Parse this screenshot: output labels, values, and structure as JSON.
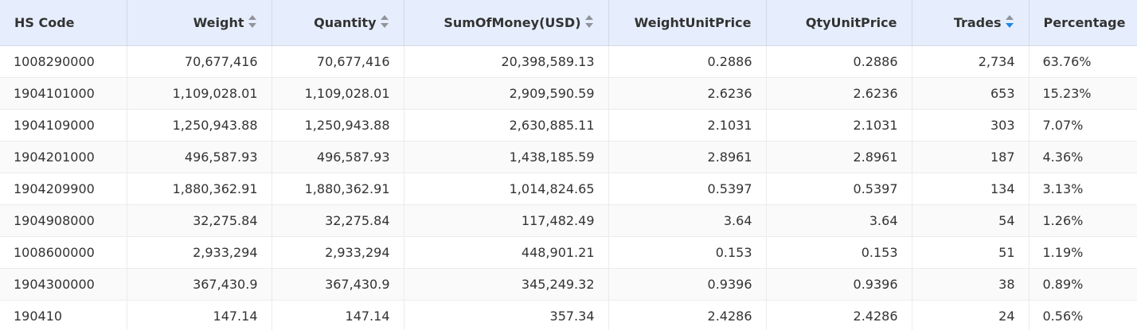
{
  "columns": [
    {
      "label": "HS Code",
      "sort": "none"
    },
    {
      "label": "Weight",
      "sort": "unsorted"
    },
    {
      "label": "Quantity",
      "sort": "unsorted"
    },
    {
      "label": "SumOfMoney(USD)",
      "sort": "unsorted"
    },
    {
      "label": "WeightUnitPrice",
      "sort": "none"
    },
    {
      "label": "QtyUnitPrice",
      "sort": "none"
    },
    {
      "label": "Trades",
      "sort": "descending"
    },
    {
      "label": "Percentage",
      "sort": "none"
    }
  ],
  "colors": {
    "header_bg": "#e6eefd",
    "sort_inactive": "#909399",
    "sort_active": "#1e88e5"
  },
  "rows": [
    [
      "1008290000",
      "70,677,416",
      "70,677,416",
      "20,398,589.13",
      "0.2886",
      "0.2886",
      "2,734",
      "63.76%"
    ],
    [
      "1904101000",
      "1,109,028.01",
      "1,109,028.01",
      "2,909,590.59",
      "2.6236",
      "2.6236",
      "653",
      "15.23%"
    ],
    [
      "1904109000",
      "1,250,943.88",
      "1,250,943.88",
      "2,630,885.11",
      "2.1031",
      "2.1031",
      "303",
      "7.07%"
    ],
    [
      "1904201000",
      "496,587.93",
      "496,587.93",
      "1,438,185.59",
      "2.8961",
      "2.8961",
      "187",
      "4.36%"
    ],
    [
      "1904209900",
      "1,880,362.91",
      "1,880,362.91",
      "1,014,824.65",
      "0.5397",
      "0.5397",
      "134",
      "3.13%"
    ],
    [
      "1904908000",
      "32,275.84",
      "32,275.84",
      "117,482.49",
      "3.64",
      "3.64",
      "54",
      "1.26%"
    ],
    [
      "1008600000",
      "2,933,294",
      "2,933,294",
      "448,901.21",
      "0.153",
      "0.153",
      "51",
      "1.19%"
    ],
    [
      "1904300000",
      "367,430.9",
      "367,430.9",
      "345,249.32",
      "0.9396",
      "0.9396",
      "38",
      "0.89%"
    ],
    [
      "190410",
      "147.14",
      "147.14",
      "357.34",
      "2.4286",
      "2.4286",
      "24",
      "0.56%"
    ]
  ]
}
